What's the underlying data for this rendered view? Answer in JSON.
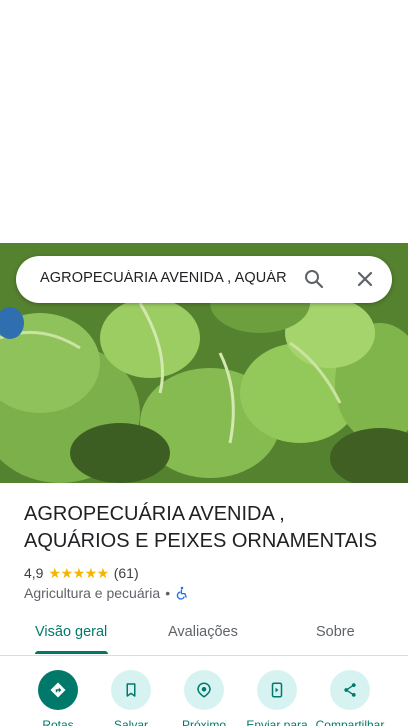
{
  "search": {
    "query": "AGROPECUÁRIA AVENIDA , AQUÁRIOS E PEIXES ORNAMENTAIS"
  },
  "place": {
    "title": "AGROPECUÁRIA AVENIDA , AQUÁRIOS E PEIXES ORNAMENTAIS",
    "rating": "4,9",
    "stars": "★★★★★",
    "review_count": "(61)",
    "category": "Agricultura e pecuária",
    "separator": "•"
  },
  "tabs": [
    {
      "label": "Visão geral",
      "active": true
    },
    {
      "label": "Avaliações",
      "active": false
    },
    {
      "label": "Sobre",
      "active": false
    }
  ],
  "actions": [
    {
      "label": "Rotas",
      "icon": "directions-icon"
    },
    {
      "label": "Salvar",
      "icon": "bookmark-icon"
    },
    {
      "label": "Próximo",
      "icon": "nearby-icon"
    },
    {
      "label": "Enviar para",
      "icon": "send-to-phone-icon"
    },
    {
      "label": "Compartilhar",
      "icon": "share-icon"
    }
  ],
  "colors": {
    "accent": "#00796b",
    "accent_light": "#d7f3f1",
    "star": "#f4b400"
  }
}
